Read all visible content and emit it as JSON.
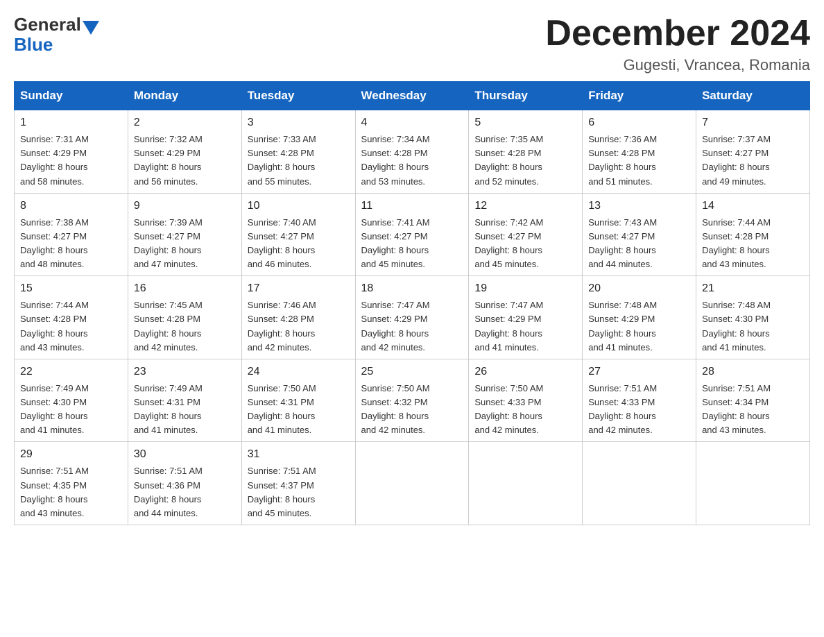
{
  "logo": {
    "general_text": "General",
    "blue_text": "Blue"
  },
  "header": {
    "month_year": "December 2024",
    "location": "Gugesti, Vrancea, Romania"
  },
  "columns": [
    "Sunday",
    "Monday",
    "Tuesday",
    "Wednesday",
    "Thursday",
    "Friday",
    "Saturday"
  ],
  "weeks": [
    [
      {
        "day": "1",
        "sunrise": "Sunrise: 7:31 AM",
        "sunset": "Sunset: 4:29 PM",
        "daylight": "Daylight: 8 hours",
        "daylight2": "and 58 minutes."
      },
      {
        "day": "2",
        "sunrise": "Sunrise: 7:32 AM",
        "sunset": "Sunset: 4:29 PM",
        "daylight": "Daylight: 8 hours",
        "daylight2": "and 56 minutes."
      },
      {
        "day": "3",
        "sunrise": "Sunrise: 7:33 AM",
        "sunset": "Sunset: 4:28 PM",
        "daylight": "Daylight: 8 hours",
        "daylight2": "and 55 minutes."
      },
      {
        "day": "4",
        "sunrise": "Sunrise: 7:34 AM",
        "sunset": "Sunset: 4:28 PM",
        "daylight": "Daylight: 8 hours",
        "daylight2": "and 53 minutes."
      },
      {
        "day": "5",
        "sunrise": "Sunrise: 7:35 AM",
        "sunset": "Sunset: 4:28 PM",
        "daylight": "Daylight: 8 hours",
        "daylight2": "and 52 minutes."
      },
      {
        "day": "6",
        "sunrise": "Sunrise: 7:36 AM",
        "sunset": "Sunset: 4:28 PM",
        "daylight": "Daylight: 8 hours",
        "daylight2": "and 51 minutes."
      },
      {
        "day": "7",
        "sunrise": "Sunrise: 7:37 AM",
        "sunset": "Sunset: 4:27 PM",
        "daylight": "Daylight: 8 hours",
        "daylight2": "and 49 minutes."
      }
    ],
    [
      {
        "day": "8",
        "sunrise": "Sunrise: 7:38 AM",
        "sunset": "Sunset: 4:27 PM",
        "daylight": "Daylight: 8 hours",
        "daylight2": "and 48 minutes."
      },
      {
        "day": "9",
        "sunrise": "Sunrise: 7:39 AM",
        "sunset": "Sunset: 4:27 PM",
        "daylight": "Daylight: 8 hours",
        "daylight2": "and 47 minutes."
      },
      {
        "day": "10",
        "sunrise": "Sunrise: 7:40 AM",
        "sunset": "Sunset: 4:27 PM",
        "daylight": "Daylight: 8 hours",
        "daylight2": "and 46 minutes."
      },
      {
        "day": "11",
        "sunrise": "Sunrise: 7:41 AM",
        "sunset": "Sunset: 4:27 PM",
        "daylight": "Daylight: 8 hours",
        "daylight2": "and 45 minutes."
      },
      {
        "day": "12",
        "sunrise": "Sunrise: 7:42 AM",
        "sunset": "Sunset: 4:27 PM",
        "daylight": "Daylight: 8 hours",
        "daylight2": "and 45 minutes."
      },
      {
        "day": "13",
        "sunrise": "Sunrise: 7:43 AM",
        "sunset": "Sunset: 4:27 PM",
        "daylight": "Daylight: 8 hours",
        "daylight2": "and 44 minutes."
      },
      {
        "day": "14",
        "sunrise": "Sunrise: 7:44 AM",
        "sunset": "Sunset: 4:28 PM",
        "daylight": "Daylight: 8 hours",
        "daylight2": "and 43 minutes."
      }
    ],
    [
      {
        "day": "15",
        "sunrise": "Sunrise: 7:44 AM",
        "sunset": "Sunset: 4:28 PM",
        "daylight": "Daylight: 8 hours",
        "daylight2": "and 43 minutes."
      },
      {
        "day": "16",
        "sunrise": "Sunrise: 7:45 AM",
        "sunset": "Sunset: 4:28 PM",
        "daylight": "Daylight: 8 hours",
        "daylight2": "and 42 minutes."
      },
      {
        "day": "17",
        "sunrise": "Sunrise: 7:46 AM",
        "sunset": "Sunset: 4:28 PM",
        "daylight": "Daylight: 8 hours",
        "daylight2": "and 42 minutes."
      },
      {
        "day": "18",
        "sunrise": "Sunrise: 7:47 AM",
        "sunset": "Sunset: 4:29 PM",
        "daylight": "Daylight: 8 hours",
        "daylight2": "and 42 minutes."
      },
      {
        "day": "19",
        "sunrise": "Sunrise: 7:47 AM",
        "sunset": "Sunset: 4:29 PM",
        "daylight": "Daylight: 8 hours",
        "daylight2": "and 41 minutes."
      },
      {
        "day": "20",
        "sunrise": "Sunrise: 7:48 AM",
        "sunset": "Sunset: 4:29 PM",
        "daylight": "Daylight: 8 hours",
        "daylight2": "and 41 minutes."
      },
      {
        "day": "21",
        "sunrise": "Sunrise: 7:48 AM",
        "sunset": "Sunset: 4:30 PM",
        "daylight": "Daylight: 8 hours",
        "daylight2": "and 41 minutes."
      }
    ],
    [
      {
        "day": "22",
        "sunrise": "Sunrise: 7:49 AM",
        "sunset": "Sunset: 4:30 PM",
        "daylight": "Daylight: 8 hours",
        "daylight2": "and 41 minutes."
      },
      {
        "day": "23",
        "sunrise": "Sunrise: 7:49 AM",
        "sunset": "Sunset: 4:31 PM",
        "daylight": "Daylight: 8 hours",
        "daylight2": "and 41 minutes."
      },
      {
        "day": "24",
        "sunrise": "Sunrise: 7:50 AM",
        "sunset": "Sunset: 4:31 PM",
        "daylight": "Daylight: 8 hours",
        "daylight2": "and 41 minutes."
      },
      {
        "day": "25",
        "sunrise": "Sunrise: 7:50 AM",
        "sunset": "Sunset: 4:32 PM",
        "daylight": "Daylight: 8 hours",
        "daylight2": "and 42 minutes."
      },
      {
        "day": "26",
        "sunrise": "Sunrise: 7:50 AM",
        "sunset": "Sunset: 4:33 PM",
        "daylight": "Daylight: 8 hours",
        "daylight2": "and 42 minutes."
      },
      {
        "day": "27",
        "sunrise": "Sunrise: 7:51 AM",
        "sunset": "Sunset: 4:33 PM",
        "daylight": "Daylight: 8 hours",
        "daylight2": "and 42 minutes."
      },
      {
        "day": "28",
        "sunrise": "Sunrise: 7:51 AM",
        "sunset": "Sunset: 4:34 PM",
        "daylight": "Daylight: 8 hours",
        "daylight2": "and 43 minutes."
      }
    ],
    [
      {
        "day": "29",
        "sunrise": "Sunrise: 7:51 AM",
        "sunset": "Sunset: 4:35 PM",
        "daylight": "Daylight: 8 hours",
        "daylight2": "and 43 minutes."
      },
      {
        "day": "30",
        "sunrise": "Sunrise: 7:51 AM",
        "sunset": "Sunset: 4:36 PM",
        "daylight": "Daylight: 8 hours",
        "daylight2": "and 44 minutes."
      },
      {
        "day": "31",
        "sunrise": "Sunrise: 7:51 AM",
        "sunset": "Sunset: 4:37 PM",
        "daylight": "Daylight: 8 hours",
        "daylight2": "and 45 minutes."
      },
      {
        "day": "",
        "sunrise": "",
        "sunset": "",
        "daylight": "",
        "daylight2": ""
      },
      {
        "day": "",
        "sunrise": "",
        "sunset": "",
        "daylight": "",
        "daylight2": ""
      },
      {
        "day": "",
        "sunrise": "",
        "sunset": "",
        "daylight": "",
        "daylight2": ""
      },
      {
        "day": "",
        "sunrise": "",
        "sunset": "",
        "daylight": "",
        "daylight2": ""
      }
    ]
  ]
}
